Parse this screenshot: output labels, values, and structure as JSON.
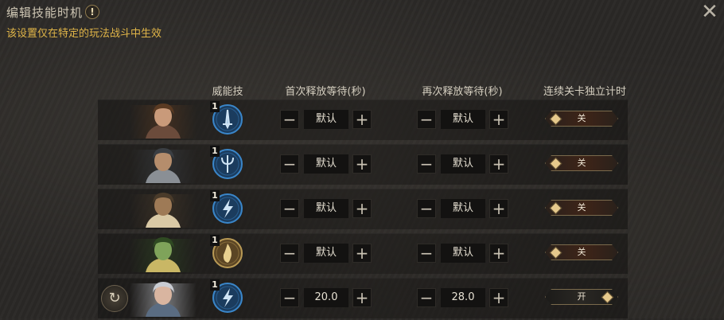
{
  "header": {
    "title": "编辑技能时机",
    "warning_glyph": "!",
    "subtitle": "该设置仅在特定的玩法战斗中生效"
  },
  "columns": {
    "skill": "威能技",
    "first_wait": "首次释放等待(秒)",
    "second_wait": "再次释放等待(秒)",
    "stage_timer": "连续关卡独立计时"
  },
  "colors": {
    "accent": "#e0b548",
    "skill_ring_blue": "#3a86c9",
    "skill_ring_gold": "#b99a55",
    "toggle_off": "#3e2418"
  },
  "rows": [
    {
      "portrait": "brown-haired-woman",
      "skill_level": "1",
      "skill_icon": "sword-skill-icon",
      "first": "默认",
      "second": "默认",
      "toggle": "关",
      "toggle_on": false
    },
    {
      "portrait": "bearded-warrior-horned-helm",
      "skill_level": "1",
      "skill_icon": "trident-skill-icon",
      "first": "默认",
      "second": "默认",
      "toggle": "关",
      "toggle_on": false
    },
    {
      "portrait": "horned-minotaur",
      "skill_level": "1",
      "skill_icon": "lightning-skill-icon",
      "first": "默认",
      "second": "默认",
      "toggle": "关",
      "toggle_on": false
    },
    {
      "portrait": "green-naga-archer",
      "skill_level": "1",
      "skill_icon": "flame-skill-icon",
      "first": "默认",
      "second": "默认",
      "toggle": "关",
      "toggle_on": false
    },
    {
      "portrait": "silver-haired-woman",
      "skill_level": "1",
      "skill_icon": "lightning-skill-icon",
      "first": "20.0",
      "second": "28.0",
      "toggle": "开",
      "toggle_on": true,
      "has_reset": true
    }
  ],
  "glyphs": {
    "minus": "−",
    "plus": "+",
    "close": "✕",
    "reset": "↻"
  }
}
